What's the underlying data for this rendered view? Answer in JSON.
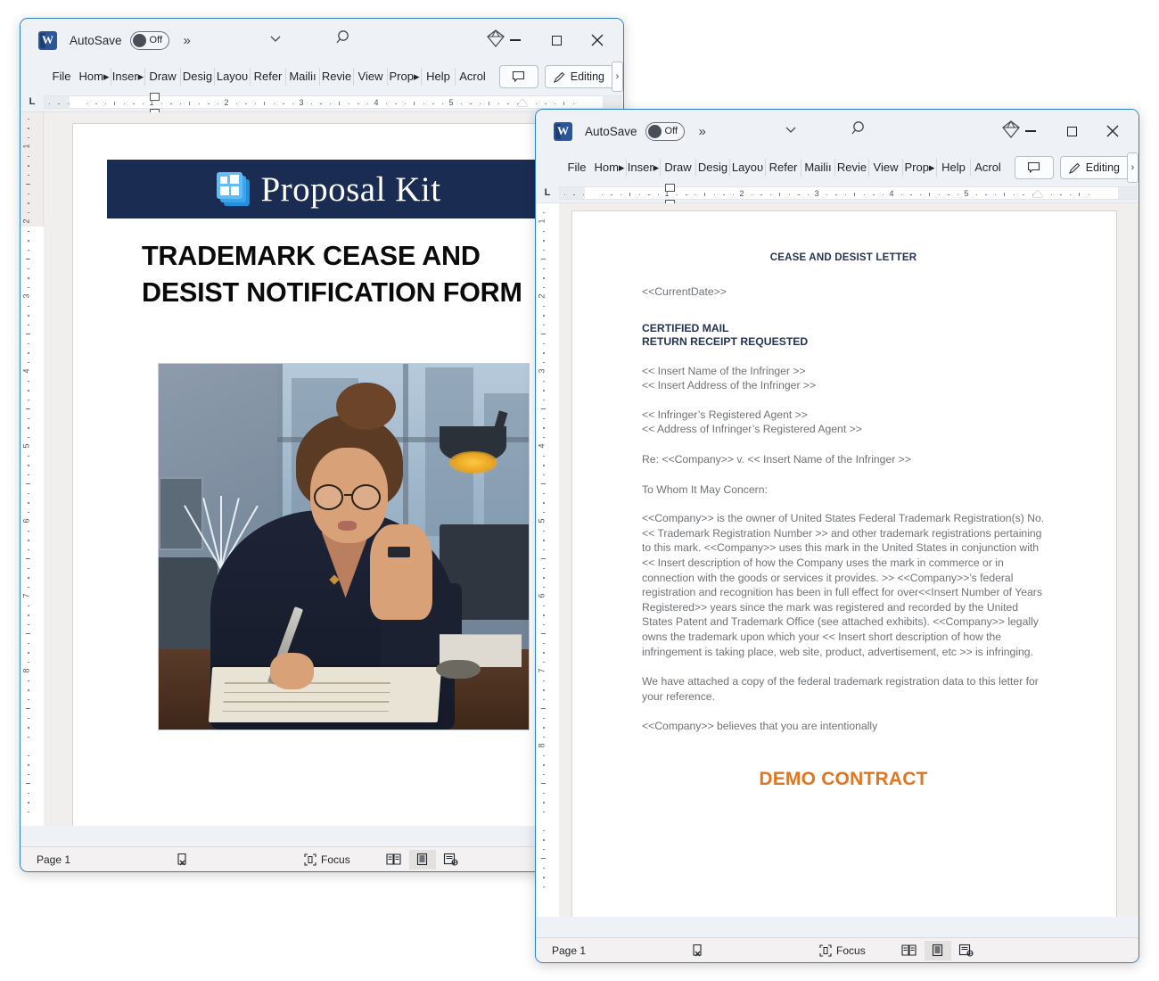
{
  "app": {
    "word_icon_letter": "W",
    "autosave_label": "AutoSave",
    "autosave_state": "Off",
    "more_chevron": "»",
    "dropdown_chevron": "∨",
    "search_icon": "search-icon",
    "copilot_icon": "diamond-icon",
    "minimize": "minimize-icon",
    "maximize": "maximize-icon",
    "close": "✕"
  },
  "ribbon": {
    "tabs": [
      "File",
      "Hom▸",
      "Inser▸",
      "Draw",
      "Desiɡ",
      "Layoυ",
      "Refer",
      "Mailiı",
      "Revie",
      "View",
      "Prop▸",
      "Help",
      "Acrol"
    ],
    "comment_button": "comment-icon",
    "editing_button": "Editing",
    "editing_icon": "pencil-icon",
    "overflow_chevron": "›"
  },
  "ruler": {
    "h_numbers": [
      "1",
      "2",
      "3",
      "4",
      "5"
    ],
    "v_numbers": [
      "1",
      "2",
      "3",
      "4",
      "5",
      "6",
      "7",
      "8"
    ],
    "tab_stop_marker": "L"
  },
  "window1": {
    "title": "Trademark Cease and Desist Notification Form",
    "banner": {
      "brand_primary": "Proposal",
      "brand_secondary": "Kit",
      "bg_color": "#1b2c52",
      "logo_name": "proposal-kit-logo"
    },
    "doc_title": "TRADEMARK CEASE AND DESIST NOTIFICATION FORM",
    "image_alt": "illustration-woman-at-desk-with-paperwork",
    "statusbar": {
      "page": "Page 1",
      "proofing_icon": "proofing-errors-icon",
      "focus": "Focus",
      "focus_icon": "focus-icon",
      "views": [
        "read-mode-icon",
        "print-layout-icon",
        "web-layout-icon"
      ],
      "active_view_index": 1
    }
  },
  "window2": {
    "title": "Cease and Desist Letter",
    "doc": {
      "heading": "CEASE AND DESIST LETTER",
      "date_field": "<<CurrentDate>>",
      "mail_line_1": "CERTIFIED MAIL",
      "mail_line_2": "RETURN RECEIPT REQUESTED",
      "infringer_name": "<< Insert Name of the Infringer >>",
      "infringer_address": "<< Insert Address of the Infringer >>",
      "agent_name": "<< Infringer’s Registered Agent >>",
      "agent_address": "<< Address of Infringer’s Registered Agent >>",
      "re_line": "Re: <<Company>> v. << Insert Name of the Infringer >>",
      "salutation": "To Whom It May Concern:",
      "body_paragraph": "<<Company>> is the owner of United States Federal Trademark Registration(s) No. << Trademark Registration Number >> and other trademark registrations pertaining to this mark. <<Company>> uses this mark in the United States in conjunction with << Insert description of how the Company uses the mark in commerce or in connection with the goods or services it provides. >> <<Company>>’s federal registration and recognition has been in full effect for over<<Insert Number of Years Registered>> years since the mark was registered and recorded by the United States Patent and Trademark Office (see attached exhibits). <<Company>> legally owns the trademark upon which your << Insert short description of how the infringement is taking place, web site, product, advertisement, etc >> is infringing.",
      "attachment_paragraph": "We have attached a copy of the federal trademark registration data to this letter for your reference.",
      "closing_paragraph": "<<Company>> believes that you are intentionally",
      "demo_watermark": "DEMO CONTRACT"
    },
    "statusbar": {
      "page": "Page 1",
      "proofing_icon": "proofing-errors-icon",
      "focus": "Focus",
      "focus_icon": "focus-icon",
      "views": [
        "read-mode-icon",
        "print-layout-icon",
        "web-layout-icon"
      ],
      "active_view_index": 1
    }
  },
  "colors": {
    "accent_navy": "#1b2c52",
    "demo_orange": "#de7622",
    "window_border": "#2a7fc9",
    "chrome_bg": "#eef2f7"
  }
}
